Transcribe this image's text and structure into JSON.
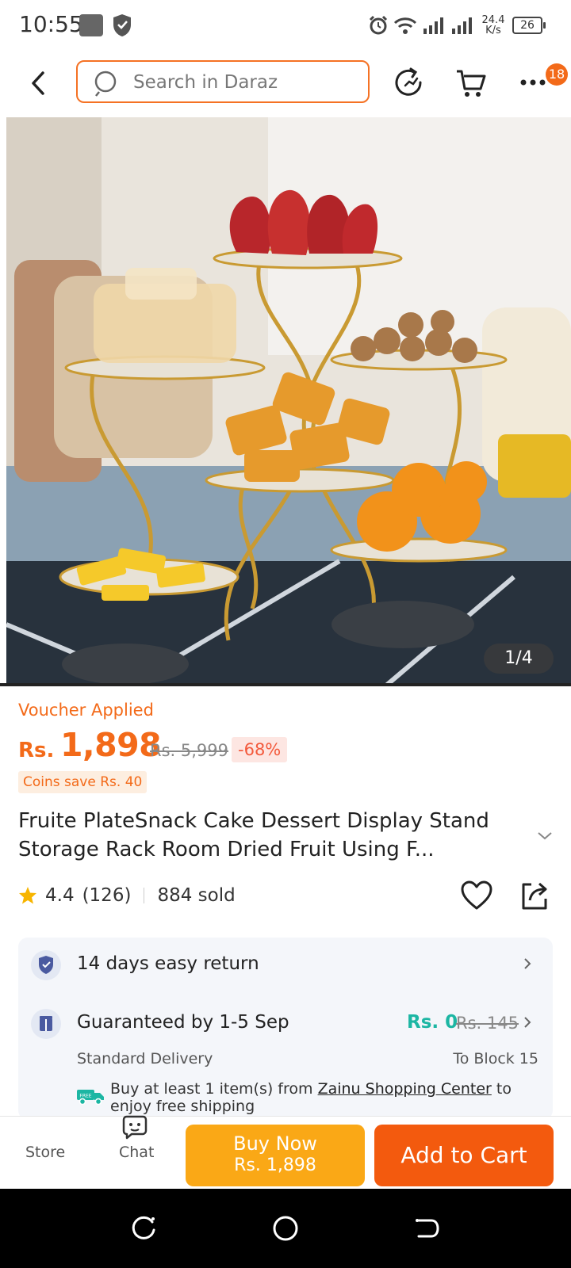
{
  "status_bar": {
    "time": "10:55",
    "net_speed_value": "24.4",
    "net_speed_unit": "K/s",
    "battery": "26"
  },
  "header": {
    "search_placeholder": "Search in Daraz",
    "more_badge": "18"
  },
  "gallery": {
    "counter": "1/4"
  },
  "product": {
    "voucher_label": "Voucher Applied",
    "currency": "Rs.",
    "price": "1,898",
    "original_price": "Rs. 5,999",
    "discount": "-68%",
    "coins_note": "Coins save Rs. 40",
    "title": "Fruite PlateSnack Cake Dessert Display Stand Storage Rack Room Dried Fruit Using F...",
    "rating": "4.4",
    "rating_count": "(126)",
    "sold": "884 sold"
  },
  "services": {
    "return_label": "14 days easy return",
    "delivery_label": "Guaranteed by 1-5 Sep",
    "delivery_price": "Rs. 0",
    "delivery_original": "Rs. 145",
    "delivery_type": "Standard Delivery",
    "delivery_destination": "To Block 15",
    "free_ship_prefix": "Buy at least 1 item(s) from ",
    "free_ship_shop": "Zainu Shopping Center",
    "free_ship_suffix": " to enjoy free shipping",
    "free_badge": "FREE"
  },
  "action_bar": {
    "store_label": "Store",
    "chat_label": "Chat",
    "buy_now_label": "Buy Now",
    "buy_now_price": "Rs. 1,898",
    "add_to_cart_label": "Add to Cart"
  },
  "colors": {
    "accent": "#f57224",
    "buy_now": "#faa816",
    "add_to_cart": "#f35a0e",
    "free_shipping": "#1cb6a3"
  },
  "icons": [
    "back-icon",
    "search-icon",
    "refresh-icon",
    "cart-icon",
    "more-icon",
    "star-icon",
    "heart-icon",
    "share-icon",
    "shield-check-icon",
    "delivery-icon",
    "free-truck-icon",
    "store-icon",
    "chat-icon"
  ]
}
